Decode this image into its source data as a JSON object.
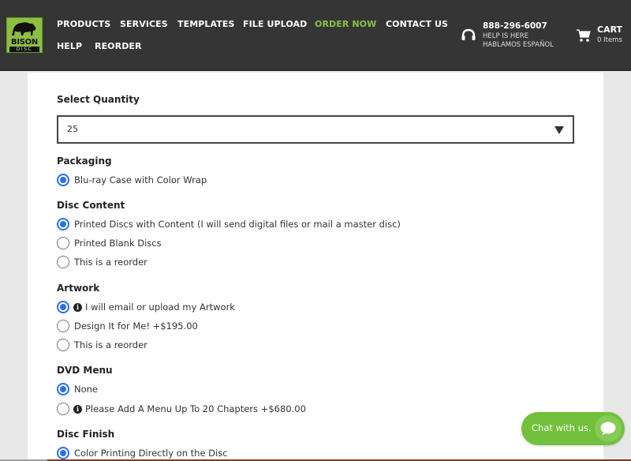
{
  "header": {
    "logo": {
      "line1": "BISON",
      "line2": "DISC"
    },
    "nav": [
      {
        "label": "PRODUCTS",
        "active": false
      },
      {
        "label": "SERVICES",
        "active": false
      },
      {
        "label": "TEMPLATES",
        "active": false
      },
      {
        "label": "FILE UPLOAD",
        "active": false
      },
      {
        "label": "ORDER NOW",
        "active": true
      },
      {
        "label": "CONTACT US",
        "active": false
      },
      {
        "label": "HELP",
        "active": false
      },
      {
        "label": "REORDER",
        "active": false
      }
    ],
    "phone": {
      "icon": "headset-icon",
      "number": "888-296-6007",
      "line1": "HELP IS HERE",
      "line2": "HABLAMOS ESPAÑOL"
    },
    "cart": {
      "icon": "cart-icon",
      "label": "CART",
      "count": "0 Items"
    }
  },
  "form": {
    "quantity": {
      "label": "Select Quantity",
      "value": "25"
    },
    "packaging": {
      "label": "Packaging",
      "options": [
        {
          "label": "Blu-ray Case with Color Wrap",
          "checked": true,
          "info": false
        }
      ]
    },
    "disc_content": {
      "label": "Disc Content",
      "options": [
        {
          "label": "Printed Discs with Content (I will send digital files or mail a master disc)",
          "checked": true,
          "info": false
        },
        {
          "label": "Printed Blank Discs",
          "checked": false,
          "info": false
        },
        {
          "label": "This is a reorder",
          "checked": false,
          "info": false
        }
      ]
    },
    "artwork": {
      "label": "Artwork",
      "options": [
        {
          "label": "I will email or upload my Artwork",
          "checked": true,
          "info": true
        },
        {
          "label": "Design It for Me! +$195.00",
          "checked": false,
          "info": false
        },
        {
          "label": "This is a reorder",
          "checked": false,
          "info": false
        }
      ]
    },
    "dvd_menu": {
      "label": "DVD Menu",
      "options": [
        {
          "label": "None",
          "checked": true,
          "info": false
        },
        {
          "label": "Please Add A Menu Up To 20 Chapters +$680.00",
          "checked": false,
          "info": true
        }
      ]
    },
    "disc_finish": {
      "label": "Disc Finish",
      "options": [
        {
          "label": "Color Printing Directly on the Disc",
          "checked": true,
          "info": false
        }
      ]
    }
  },
  "chat": {
    "label": "Chat with us.",
    "icon": "chat-bubble-icon"
  },
  "colors": {
    "header_bg": "#353535",
    "accent_green": "#8dc144",
    "radio_blue": "#2a6ef2",
    "chat_green": "#72c03c"
  }
}
